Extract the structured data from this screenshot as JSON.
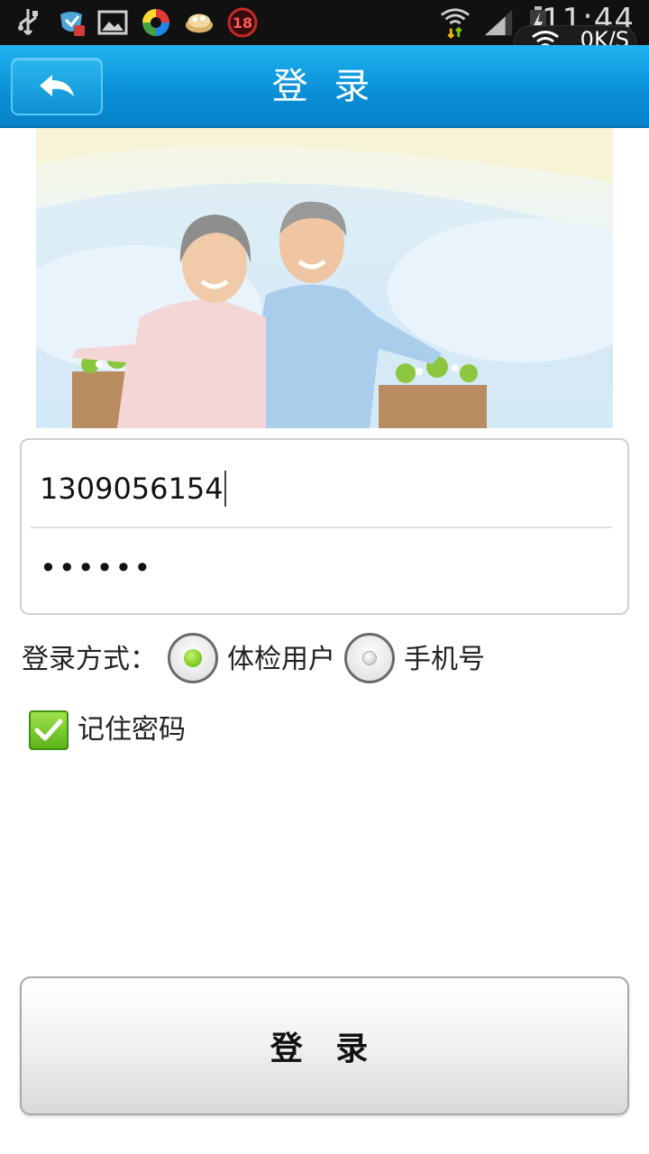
{
  "status_bar": {
    "time": "11:44",
    "net_speed": "0K/S",
    "icons": [
      "usb-icon",
      "shield-icon",
      "gallery-icon",
      "app-icon",
      "food-icon",
      "age-18-icon",
      "wifi-data-icon",
      "signal-icon",
      "battery-icon",
      "wifi-icon"
    ],
    "badge_18": "18"
  },
  "header": {
    "title": "登 录",
    "back_icon": "back-arrow-icon"
  },
  "form": {
    "username_value": "1309056154",
    "password_value": "••••••"
  },
  "login_method": {
    "label": "登录方式：",
    "options": [
      {
        "label": "体检用户",
        "selected": true
      },
      {
        "label": "手机号",
        "selected": false
      }
    ]
  },
  "remember": {
    "label": "记住密码",
    "checked": true
  },
  "login_button": {
    "label": "登 录"
  },
  "colors": {
    "header_blue": "#0a8fd6",
    "radio_selected": "#52b200",
    "checkbox_green": "#5cb317"
  }
}
